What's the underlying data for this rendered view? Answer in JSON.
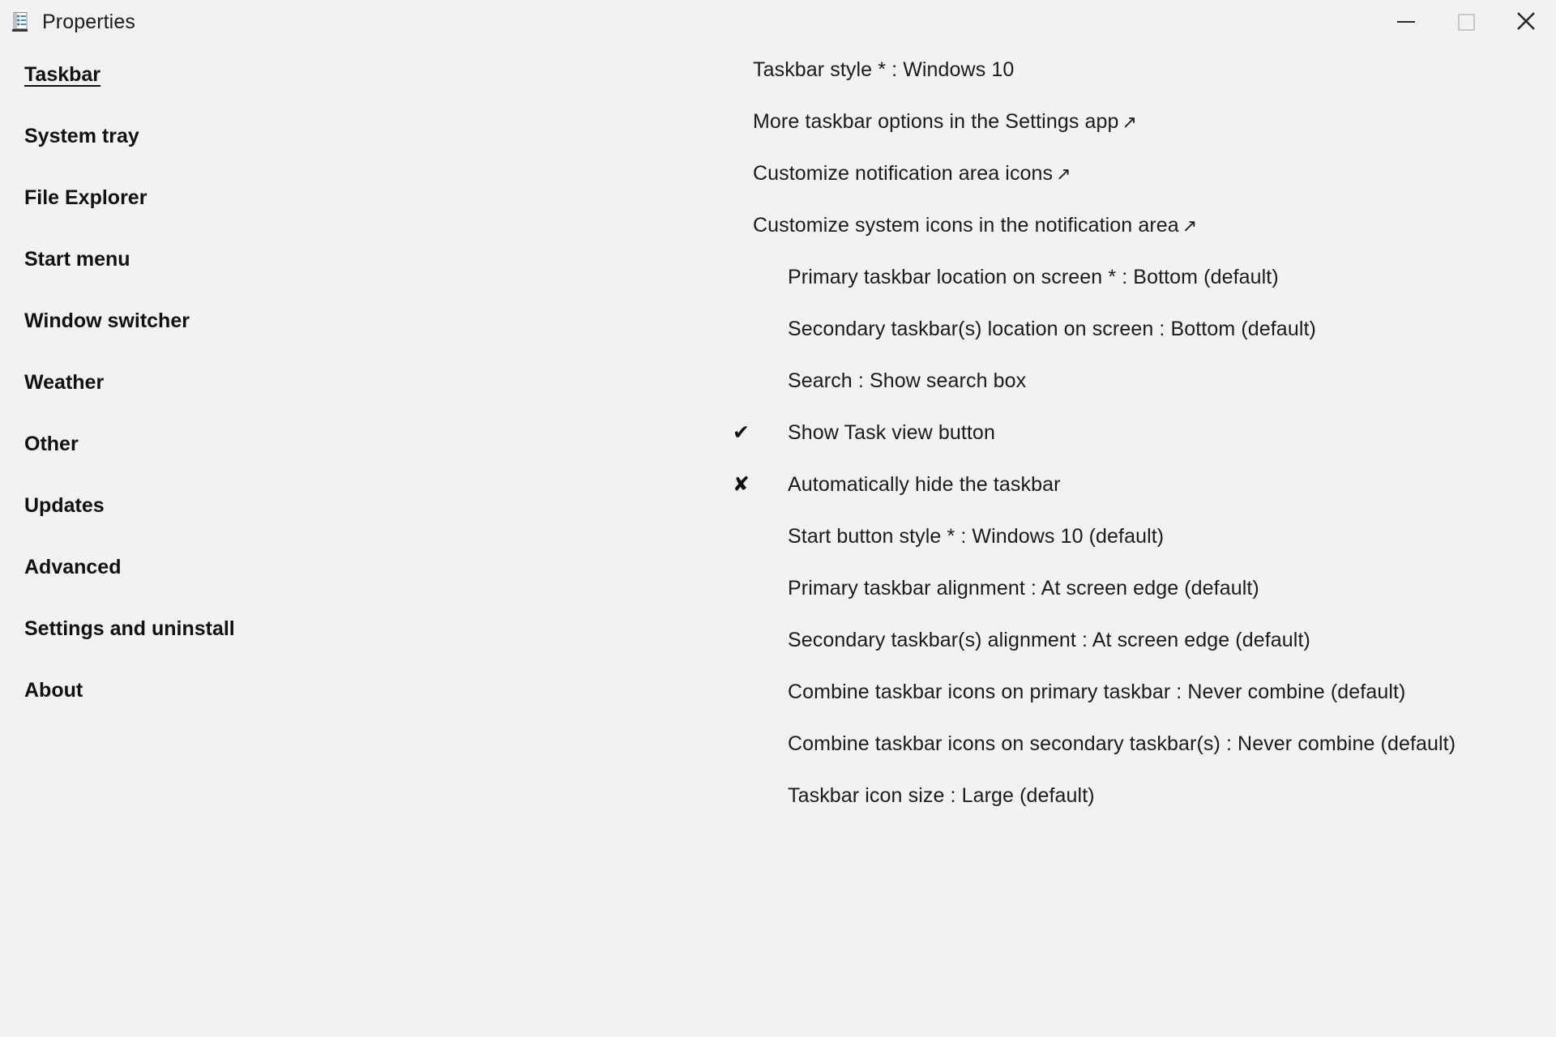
{
  "window": {
    "title": "Properties",
    "icon": "properties-list-icon",
    "controls": {
      "minimize": "minimize-icon",
      "maximize": "maximize-icon",
      "close": "close-icon"
    }
  },
  "colors": {
    "background": "#f2f2f2",
    "text": "#1b1b1b",
    "icon_accent": "#2a7fd4",
    "maximize_disabled": "#c8c8c8"
  },
  "sidebar": {
    "items": [
      {
        "label": "Taskbar",
        "active": true
      },
      {
        "label": "System tray",
        "active": false
      },
      {
        "label": "File Explorer",
        "active": false
      },
      {
        "label": "Start menu",
        "active": false
      },
      {
        "label": "Window switcher",
        "active": false
      },
      {
        "label": "Weather",
        "active": false
      },
      {
        "label": "Other",
        "active": false
      },
      {
        "label": "Updates",
        "active": false
      },
      {
        "label": "Advanced",
        "active": false
      },
      {
        "label": "Settings and uninstall",
        "active": false
      },
      {
        "label": "About",
        "active": false
      }
    ]
  },
  "content": {
    "rows": [
      {
        "text": "Taskbar style * : Windows 10",
        "indent": false,
        "mark": "",
        "link": false
      },
      {
        "text": "More taskbar options in the Settings app",
        "indent": false,
        "mark": "",
        "link": true
      },
      {
        "text": "Customize notification area icons",
        "indent": false,
        "mark": "",
        "link": true
      },
      {
        "text": "Customize system icons in the notification area",
        "indent": false,
        "mark": "",
        "link": true
      },
      {
        "text": "Primary taskbar location on screen * : Bottom (default)",
        "indent": true,
        "mark": "",
        "link": false
      },
      {
        "text": "Secondary taskbar(s) location on screen : Bottom (default)",
        "indent": true,
        "mark": "",
        "link": false
      },
      {
        "text": "Search : Show search box",
        "indent": true,
        "mark": "",
        "link": false
      },
      {
        "text": "Show Task view button",
        "indent": true,
        "mark": "✔",
        "link": false
      },
      {
        "text": "Automatically hide the taskbar",
        "indent": true,
        "mark": "✘",
        "link": false
      },
      {
        "text": "Start button style * : Windows 10 (default)",
        "indent": true,
        "mark": "",
        "link": false
      },
      {
        "text": "Primary taskbar alignment : At screen edge (default)",
        "indent": true,
        "mark": "",
        "link": false
      },
      {
        "text": "Secondary taskbar(s) alignment : At screen edge (default)",
        "indent": true,
        "mark": "",
        "link": false
      },
      {
        "text": "Combine taskbar icons on primary taskbar : Never combine (default)",
        "indent": true,
        "mark": "",
        "link": false
      },
      {
        "text": "Combine taskbar icons on secondary taskbar(s) : Never combine (default)",
        "indent": true,
        "mark": "",
        "link": false
      },
      {
        "text": "Taskbar icon size : Large (default)",
        "indent": true,
        "mark": "",
        "link": false
      }
    ],
    "external_link_glyph": "↗"
  }
}
